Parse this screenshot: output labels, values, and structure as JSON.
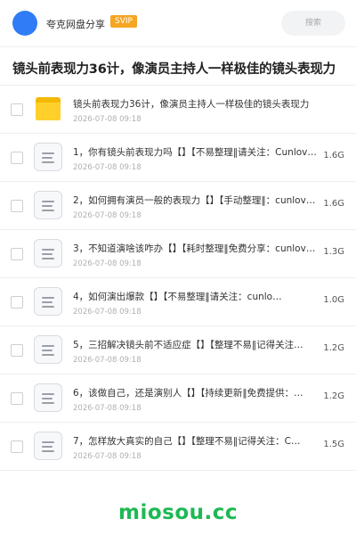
{
  "header": {
    "app_name": "夸克网盘分享",
    "vip_badge": "SVIP",
    "search_placeholder": "搜索",
    "accent_color": "#2f7cf6",
    "badge_color": "#f5a623"
  },
  "page_title": "镜头前表现力36计，像演员主持人一样极佳的镜头表现力",
  "files": [
    {
      "type": "folder",
      "name": "镜头前表现力36计，像演员主持人一样极佳的镜头表现力",
      "date": "2026-07-08 09:18",
      "size": "",
      "icon": "folder-icon"
    },
    {
      "type": "file",
      "name": "1，你有镜头前表现力吗【】【不易整理‖请关注：Cunlove…",
      "date": "2026-07-08 09:18",
      "size": "1.6G",
      "icon": "document-icon"
    },
    {
      "type": "file",
      "name": "2，如何拥有演员一般的表现力【】【手动整理‖：cunlove…",
      "date": "2026-07-08 09:18",
      "size": "1.6G",
      "icon": "document-icon"
    },
    {
      "type": "file",
      "name": "3，不知道演啥该咋办【】【耗时整理‖免费分享：cunlove…",
      "date": "2026-07-08 09:18",
      "size": "1.3G",
      "icon": "document-icon"
    },
    {
      "type": "file",
      "name": "4，如何演出爆款【】【不易整理‖请关注：cunlo…",
      "date": "2026-07-08 09:18",
      "size": "1.0G",
      "icon": "document-icon"
    },
    {
      "type": "file",
      "name": "5，三招解决镜头前不适应症【】【整理不易‖记得关注…",
      "date": "2026-07-08 09:18",
      "size": "1.2G",
      "icon": "document-icon"
    },
    {
      "type": "file",
      "name": "6，该做自己，还是演别人【】【持续更新‖免费提供：…",
      "date": "2026-07-08 09:18",
      "size": "1.2G",
      "icon": "document-icon"
    },
    {
      "type": "file",
      "name": "7，怎样放大真实的自己【】【整理不易‖记得关注：C…",
      "date": "2026-07-08 09:18",
      "size": "1.5G",
      "icon": "document-icon"
    }
  ],
  "watermark": "miosou.cc",
  "watermark_color": "#1db954"
}
